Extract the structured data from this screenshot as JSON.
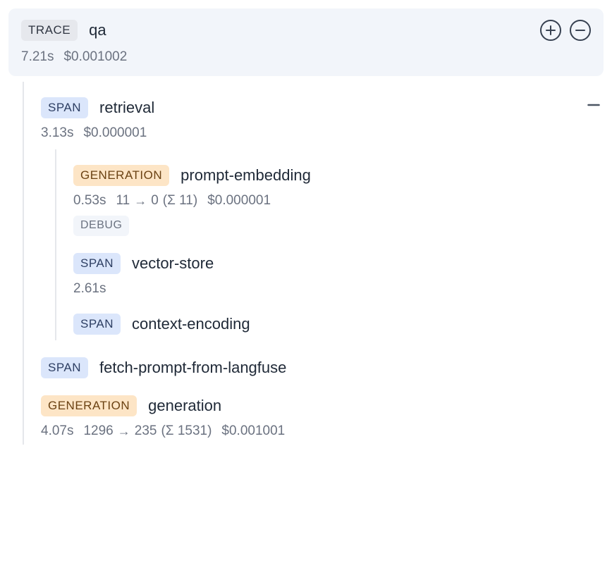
{
  "trace": {
    "badge": "TRACE",
    "title": "qa",
    "duration": "7.21s",
    "cost": "$0.001002"
  },
  "children": {
    "retrieval": {
      "badge": "SPAN",
      "title": "retrieval",
      "duration": "3.13s",
      "cost": "$0.000001"
    },
    "prompt_embedding": {
      "badge": "GENERATION",
      "title": "prompt-embedding",
      "duration": "0.53s",
      "tokens_in": "11",
      "tokens_out": "0",
      "tokens_sum": "(Σ 11)",
      "cost": "$0.000001",
      "debug_badge": "DEBUG"
    },
    "vector_store": {
      "badge": "SPAN",
      "title": "vector-store",
      "duration": "2.61s"
    },
    "context_encoding": {
      "badge": "SPAN",
      "title": "context-encoding"
    },
    "fetch_prompt": {
      "badge": "SPAN",
      "title": "fetch-prompt-from-langfuse"
    },
    "generation": {
      "badge": "GENERATION",
      "title": "generation",
      "duration": "4.07s",
      "tokens_in": "1296",
      "tokens_out": "235",
      "tokens_sum": "(Σ 1531)",
      "cost": "$0.001001"
    }
  }
}
